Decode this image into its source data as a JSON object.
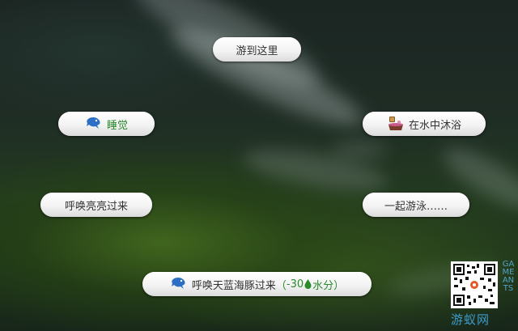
{
  "menu": {
    "swim_here": "游到这里",
    "sleep": "睡觉",
    "bathe": "在水中沐浴",
    "summon_liangliang": "呼唤亮亮过来",
    "swim_together": "一起游泳……",
    "summon_dolphin": "呼唤天蓝海豚过来",
    "summon_dolphin_cost_open": "（",
    "summon_dolphin_cost_value": "-30",
    "summon_dolphin_cost_unit": "水分）"
  },
  "icons": {
    "sleep": "dolphin-icon",
    "bathe": "bath-icon",
    "summon_dolphin": "dolphin-icon",
    "cost": "water-drop-icon"
  },
  "watermark": {
    "vertical": "GAMEANTS",
    "chinese": "游蚁网"
  },
  "colors": {
    "pill_text": "#333333",
    "accent_green": "#2b8a2b",
    "dolphin_blue": "#2d6fc4",
    "watermark_blue": "#3d9ccc"
  }
}
